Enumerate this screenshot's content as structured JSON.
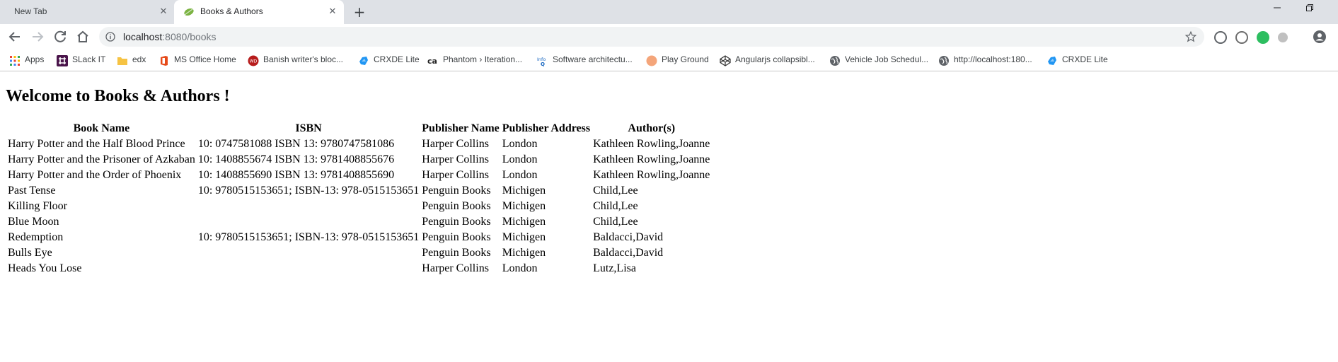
{
  "browser": {
    "tabs": [
      {
        "label": "New Tab",
        "active": false
      },
      {
        "label": "Books & Authors",
        "active": true
      }
    ],
    "new_tab_symbol": "+",
    "address": {
      "host": "localhost",
      "path": ":8080/books"
    },
    "window_controls": [
      "minimize-icon",
      "restore-icon",
      "close-icon"
    ],
    "extensions": [
      "vivaldi-icon",
      "extension-icon",
      "evernote-icon",
      "toggle-icon",
      "profile-icon"
    ]
  },
  "bookmarks": [
    {
      "label": "Apps",
      "icon": "apps-grid-icon",
      "color": "#ea4335"
    },
    {
      "label": "SLack IT",
      "icon": "slack-icon",
      "color": "#4a154b"
    },
    {
      "label": "edx",
      "icon": "folder-icon",
      "color": "#f6c343"
    },
    {
      "label": "MS Office Home",
      "icon": "office-icon",
      "color": "#e64a19"
    },
    {
      "label": "Banish writer's bloc...",
      "icon": "site-icon",
      "color": "#b71c1c"
    },
    {
      "label": "CRXDE Lite",
      "icon": "crxde-icon",
      "color": "#2196f3"
    },
    {
      "label": "Phantom › Iteration...",
      "icon": "ca-icon",
      "color": "#222222"
    },
    {
      "label": "Software architectu...",
      "icon": "infoq-icon",
      "color": "#1565c0"
    },
    {
      "label": "Play Ground",
      "icon": "playground-icon",
      "color": "#f4a57a"
    },
    {
      "label": "Angularjs collapsibl...",
      "icon": "codepen-icon",
      "color": "#333333"
    },
    {
      "label": "Vehicle Job Schedul...",
      "icon": "globe-icon",
      "color": "#5f6368"
    },
    {
      "label": "http://localhost:180...",
      "icon": "globe-icon",
      "color": "#5f6368"
    },
    {
      "label": "CRXDE Lite",
      "icon": "crxde-icon",
      "color": "#2196f3"
    }
  ],
  "page": {
    "title": "Welcome to Books & Authors !",
    "table": {
      "headers": [
        "Book Name",
        "ISBN",
        "Publisher Name",
        "Publisher Address",
        "Author(s)"
      ],
      "rows": [
        [
          "Harry Potter and the Half Blood Prince",
          "10: 0747581088 ISBN 13: 9780747581086",
          "Harper Collins",
          "London",
          "Kathleen Rowling,Joanne"
        ],
        [
          "Harry Potter and the Prisoner of Azkaban",
          "10: 1408855674 ISBN 13: 9781408855676",
          "Harper Collins",
          "London",
          "Kathleen Rowling,Joanne"
        ],
        [
          "Harry Potter and the Order of Phoenix",
          "10: 1408855690 ISBN 13: 9781408855690",
          "Harper Collins",
          "London",
          "Kathleen Rowling,Joanne"
        ],
        [
          "Past Tense",
          "10: 9780515153651; ISBN-13: 978-0515153651",
          "Penguin Books",
          "Michigen",
          "Child,Lee"
        ],
        [
          "Killing Floor",
          "",
          "Penguin Books",
          "Michigen",
          "Child,Lee"
        ],
        [
          "Blue Moon",
          "",
          "Penguin Books",
          "Michigen",
          "Child,Lee"
        ],
        [
          "Redemption",
          "10: 9780515153651; ISBN-13: 978-0515153651",
          "Penguin Books",
          "Michigen",
          "Baldacci,David"
        ],
        [
          "Bulls Eye",
          "",
          "Penguin Books",
          "Michigen",
          "Baldacci,David"
        ],
        [
          "Heads You Lose",
          "",
          "Harper Collins",
          "London",
          "Lutz,Lisa"
        ]
      ]
    }
  }
}
